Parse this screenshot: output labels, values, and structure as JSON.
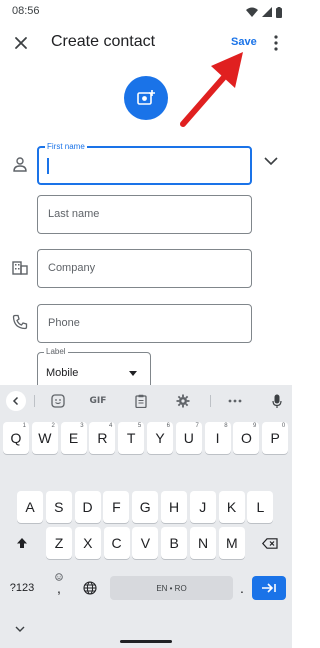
{
  "status_bar": {
    "time": "08:56"
  },
  "app_bar": {
    "title": "Create contact",
    "save_label": "Save"
  },
  "form": {
    "first_name": {
      "label": "First name",
      "value": ""
    },
    "last_name": {
      "placeholder": "Last name"
    },
    "company": {
      "placeholder": "Company"
    },
    "phone": {
      "placeholder": "Phone"
    },
    "phone_label": {
      "label": "Label",
      "value": "Mobile"
    }
  },
  "keyboard": {
    "toolbar": {
      "gif_label": "GIF"
    },
    "row1": [
      {
        "key": "Q",
        "hint": "1"
      },
      {
        "key": "W",
        "hint": "2"
      },
      {
        "key": "E",
        "hint": "3"
      },
      {
        "key": "R",
        "hint": "4"
      },
      {
        "key": "T",
        "hint": "5"
      },
      {
        "key": "Y",
        "hint": "6"
      },
      {
        "key": "U",
        "hint": "7"
      },
      {
        "key": "I",
        "hint": "8"
      },
      {
        "key": "O",
        "hint": "9"
      },
      {
        "key": "P",
        "hint": "0"
      }
    ],
    "row2": [
      "A",
      "S",
      "D",
      "F",
      "G",
      "H",
      "J",
      "K",
      "L"
    ],
    "row3": [
      "Z",
      "X",
      "C",
      "V",
      "B",
      "N",
      "M"
    ],
    "symbols_label": "?123",
    "comma_label": ",",
    "space_label": "EN • RO",
    "period_label": "."
  },
  "colors": {
    "accent": "#1a73e8",
    "keyboard_bg": "#e8eaed",
    "arrow": "#e02020"
  }
}
